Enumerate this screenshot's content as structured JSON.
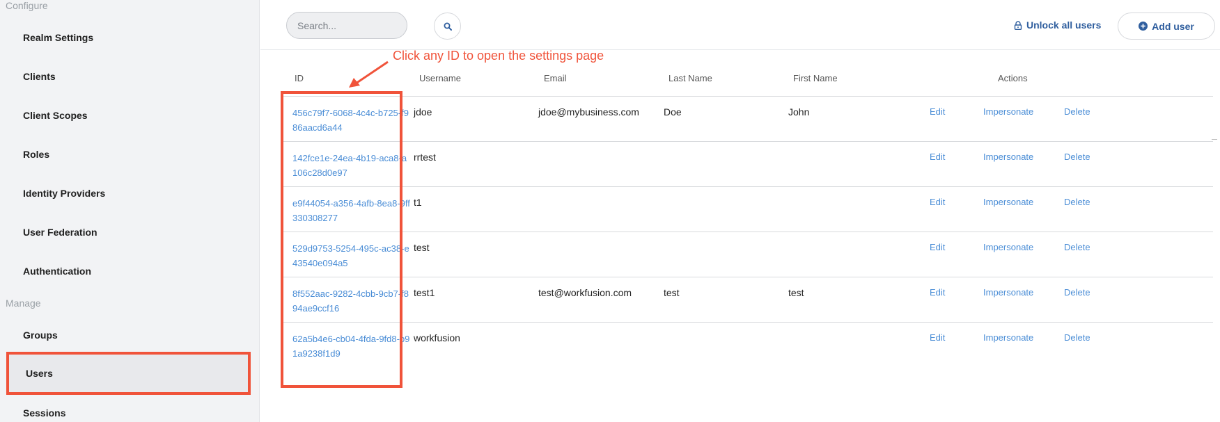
{
  "sidebar": {
    "configure_label": "Configure",
    "manage_label": "Manage",
    "configure_items": [
      {
        "label": "Realm Settings"
      },
      {
        "label": "Clients"
      },
      {
        "label": "Client Scopes"
      },
      {
        "label": "Roles"
      },
      {
        "label": "Identity Providers"
      },
      {
        "label": "User Federation"
      },
      {
        "label": "Authentication"
      }
    ],
    "manage_items": [
      {
        "label": "Groups"
      },
      {
        "label": "Users",
        "active": true
      },
      {
        "label": "Sessions"
      }
    ]
  },
  "toolbar": {
    "search_placeholder": "Search...",
    "unlock_label": "Unlock all users",
    "add_label": "Add user"
  },
  "annotation": {
    "text": "Click any ID to open the settings page"
  },
  "table": {
    "headers": {
      "id": "ID",
      "username": "Username",
      "email": "Email",
      "last_name": "Last Name",
      "first_name": "First Name",
      "actions": "Actions"
    },
    "action_labels": {
      "edit": "Edit",
      "impersonate": "Impersonate",
      "delete": "Delete"
    },
    "rows": [
      {
        "id": "456c79f7-6068-4c4c-b725-f986aacd6a44",
        "username": "jdoe",
        "email": "jdoe@mybusiness.com",
        "last_name": "Doe",
        "first_name": "John"
      },
      {
        "id": "142fce1e-24ea-4b19-aca8-a106c28d0e97",
        "username": "rrtest",
        "email": "",
        "last_name": "",
        "first_name": ""
      },
      {
        "id": "e9f44054-a356-4afb-8ea8-9ff330308277",
        "username": "t1",
        "email": "",
        "last_name": "",
        "first_name": ""
      },
      {
        "id": "529d9753-5254-495c-ac38-e43540e094a5",
        "username": "test",
        "email": "",
        "last_name": "",
        "first_name": ""
      },
      {
        "id": "8f552aac-9282-4cbb-9cb7-f894ae9ccf16",
        "username": "test1",
        "email": "test@workfusion.com",
        "last_name": "test",
        "first_name": "test"
      },
      {
        "id": "62a5b4e6-cb04-4fda-9fd8-b91a9238f1d9",
        "username": "workfusion",
        "email": "",
        "last_name": "",
        "first_name": ""
      }
    ]
  },
  "colors": {
    "accent_link": "#4a8dd6",
    "primary_button_text": "#2f5e9e",
    "annotation": "#f0533a",
    "sidebar_bg": "#f2f3f5"
  },
  "icons": {
    "search": "search-icon",
    "unlock": "lock-icon",
    "add": "plus-circle-icon"
  }
}
